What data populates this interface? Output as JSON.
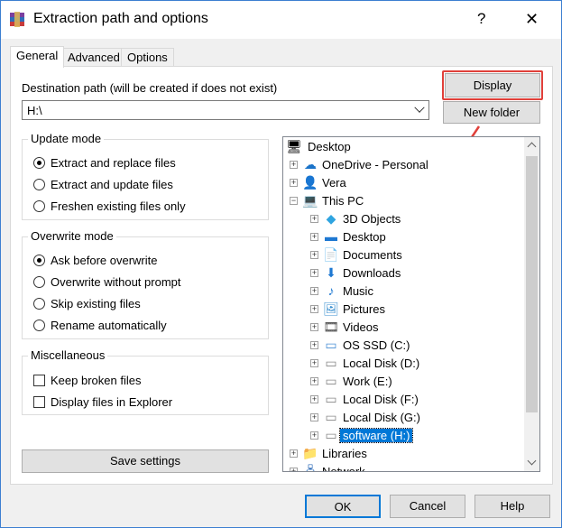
{
  "window": {
    "title": "Extraction path and options",
    "help_glyph": "?",
    "close_glyph": "✕"
  },
  "tabs": [
    {
      "label": "General"
    },
    {
      "label": "Advanced"
    },
    {
      "label": "Options"
    }
  ],
  "destination": {
    "label": "Destination path (will be created if does not exist)",
    "value": "H:\\"
  },
  "buttons": {
    "display": "Display",
    "new_folder": "New folder",
    "save_settings": "Save settings",
    "ok": "OK",
    "cancel": "Cancel",
    "help": "Help"
  },
  "update_mode": {
    "title": "Update mode",
    "options": [
      {
        "label": "Extract and replace files",
        "selected": true
      },
      {
        "label": "Extract and update files",
        "selected": false
      },
      {
        "label": "Freshen existing files only",
        "selected": false
      }
    ]
  },
  "overwrite_mode": {
    "title": "Overwrite mode",
    "options": [
      {
        "label": "Ask before overwrite",
        "selected": true
      },
      {
        "label": "Overwrite without prompt",
        "selected": false
      },
      {
        "label": "Skip existing files",
        "selected": false
      },
      {
        "label": "Rename automatically",
        "selected": false
      }
    ]
  },
  "miscellaneous": {
    "title": "Miscellaneous",
    "options": [
      {
        "label": "Keep broken files",
        "checked": false
      },
      {
        "label": "Display files in Explorer",
        "checked": false
      }
    ]
  },
  "tree": {
    "items": [
      {
        "label": "Desktop",
        "icon": "desktop-icon",
        "level": 0
      },
      {
        "label": "OneDrive - Personal",
        "icon": "cloud-icon",
        "level": 1
      },
      {
        "label": "Vera",
        "icon": "user-icon",
        "level": 1
      },
      {
        "label": "This PC",
        "icon": "computer-icon",
        "level": 1
      },
      {
        "label": "3D Objects",
        "icon": "cube-icon",
        "level": 2
      },
      {
        "label": "Desktop",
        "icon": "desktop-icon",
        "level": 2
      },
      {
        "label": "Documents",
        "icon": "document-icon",
        "level": 2
      },
      {
        "label": "Downloads",
        "icon": "download-icon",
        "level": 2
      },
      {
        "label": "Music",
        "icon": "music-icon",
        "level": 2
      },
      {
        "label": "Pictures",
        "icon": "picture-icon",
        "level": 2
      },
      {
        "label": "Videos",
        "icon": "video-icon",
        "level": 2
      },
      {
        "label": "OS SSD (C:)",
        "icon": "drive-icon",
        "level": 2
      },
      {
        "label": "Local Disk (D:)",
        "icon": "drive-icon",
        "level": 2
      },
      {
        "label": "Work (E:)",
        "icon": "drive-icon",
        "level": 2
      },
      {
        "label": "Local Disk (F:)",
        "icon": "drive-icon",
        "level": 2
      },
      {
        "label": "Local Disk (G:)",
        "icon": "drive-icon",
        "level": 2
      },
      {
        "label": "software (H:)",
        "icon": "drive-icon",
        "level": 2,
        "selected": true
      },
      {
        "label": "Libraries",
        "icon": "library-icon",
        "level": 1
      },
      {
        "label": "Network",
        "icon": "network-icon",
        "level": 1
      }
    ]
  },
  "colors": {
    "accent": "#0078d7",
    "highlight_box": "#e0403a",
    "annotation_arrow": "#e0403a"
  }
}
